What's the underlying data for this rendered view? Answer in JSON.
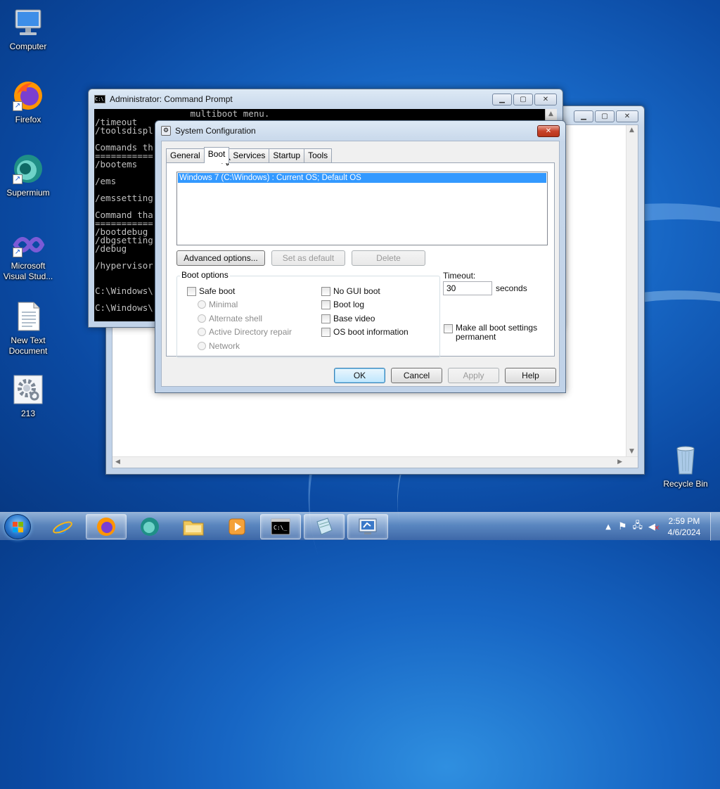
{
  "desktop": {
    "icons": [
      {
        "label": "Computer"
      },
      {
        "label": "Firefox"
      },
      {
        "label": "Supermium"
      },
      {
        "label": "Microsoft Visual Stud..."
      },
      {
        "label": "New Text Document"
      },
      {
        "label": "213"
      },
      {
        "label": "Recycle Bin"
      }
    ]
  },
  "cmd": {
    "title": "Administrator: Command Prompt",
    "lines": [
      "                  multiboot menu.",
      "/timeout",
      "/toolsdispl",
      "",
      "Commands th",
      "===========",
      "/bootems",
      "",
      "/ems",
      "",
      "/emssetting",
      "",
      "Command tha",
      "===========",
      "/bootdebug",
      "/dbgsetting",
      "/debug",
      "",
      "/hypervisor",
      "",
      "",
      "C:\\Windows\\",
      "",
      "C:\\Windows\\"
    ]
  },
  "msconfig": {
    "title": "System Configuration",
    "tabs": [
      "General",
      "Boot",
      "Services",
      "Startup",
      "Tools"
    ],
    "active_tab": "Boot",
    "os_entries": [
      "Windows 7 (C:\\Windows) : Current OS; Default OS"
    ],
    "buttons": {
      "advanced": "Advanced options...",
      "set_default": "Set as default",
      "delete": "Delete"
    },
    "boot_options": {
      "label": "Boot options",
      "safe_boot": "Safe boot",
      "minimal": "Minimal",
      "alternate_shell": "Alternate shell",
      "ad_repair": "Active Directory repair",
      "network": "Network",
      "no_gui_boot": "No GUI boot",
      "boot_log": "Boot log",
      "base_video": "Base video",
      "os_boot_info": "OS boot information"
    },
    "timeout": {
      "label": "Timeout:",
      "value": "30",
      "unit": "seconds"
    },
    "make_permanent": "Make all boot settings permanent",
    "footer": {
      "ok": "OK",
      "cancel": "Cancel",
      "apply": "Apply",
      "help": "Help"
    }
  },
  "taskbar": {
    "time": "2:59 PM",
    "date": "4/6/2024"
  }
}
